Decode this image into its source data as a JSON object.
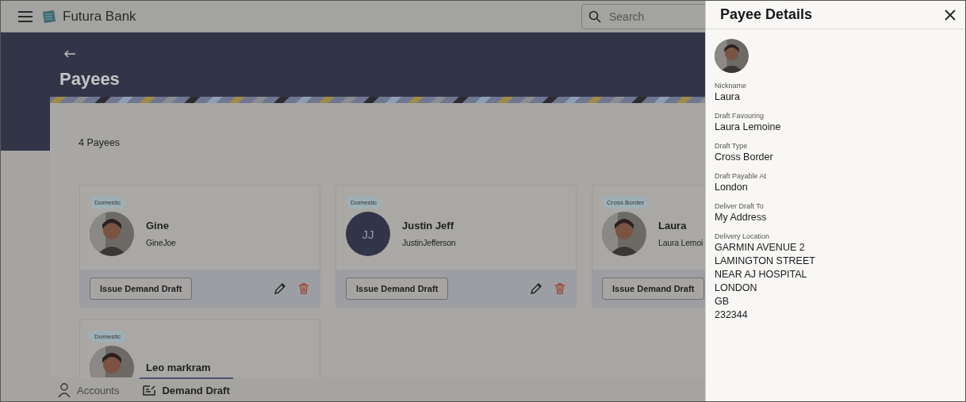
{
  "app": {
    "name": "Futura Bank"
  },
  "search": {
    "placeholder": "Search"
  },
  "page": {
    "title": "Payees",
    "count": "4 Payees"
  },
  "payees": [
    {
      "type": "Domestic",
      "name": "Gine",
      "nickname": "GineJoe",
      "action": "Issue Demand Draft",
      "tools": [
        {
          "kind": "edit"
        },
        {
          "kind": "delete"
        }
      ]
    },
    {
      "type": "Domestic",
      "name": "Justin Jeff",
      "nickname": "JustinJefferson",
      "avatar": {
        "kind": "initials",
        "text": "JJ"
      },
      "action": "Issue Demand Draft",
      "tools": [
        {
          "kind": "edit"
        },
        {
          "kind": "delete"
        }
      ]
    },
    {
      "type": "Cross Border",
      "name": "Laura",
      "nickname": "Laura Lemoi",
      "action": "Issue Demand Draft"
    },
    {
      "type": "Domestic",
      "name": "Leo markram"
    }
  ],
  "bottom_nav": [
    {
      "label": "Accounts",
      "selected": false
    },
    {
      "label": "Demand Draft",
      "selected": true
    }
  ],
  "drawer": {
    "title": "Payee Details",
    "fields": [
      {
        "label": "Nickname",
        "value": "Laura"
      },
      {
        "label": "Draft Favouring",
        "value": "Laura Lemoine"
      },
      {
        "label": "Draft Type",
        "value": "Cross Border"
      },
      {
        "label": "Draft Payable At",
        "value": "London"
      },
      {
        "label": "Deliver Draft To",
        "value": "My Address"
      },
      {
        "label": "Delivery Location",
        "lines": [
          "GARMIN AVENUE 2",
          "LAMINGTON STREET",
          "NEAR AJ HOSPITAL",
          "LONDON",
          "GB",
          "232344"
        ]
      }
    ]
  }
}
